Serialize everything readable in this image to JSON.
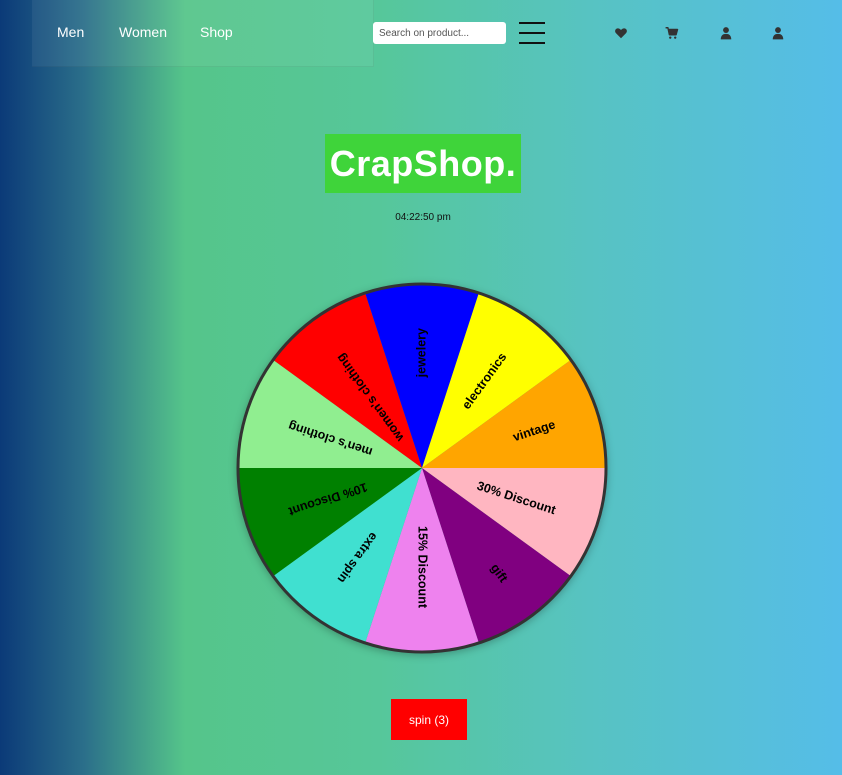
{
  "nav": {
    "links": [
      "Men",
      "Women",
      "Shop"
    ],
    "search_placeholder": "Search on product..."
  },
  "header_icons": [
    "heart-icon",
    "cart-icon",
    "user-icon",
    "account-icon"
  ],
  "logo": {
    "text": "CrapShop.",
    "bg_color": "#3fd43a"
  },
  "clock": {
    "time": "04:22:50 pm"
  },
  "wheel": {
    "segments": [
      {
        "label": "30% Discount",
        "color": "#ffb6c1"
      },
      {
        "label": "gift",
        "color": "#800080"
      },
      {
        "label": "15% Discount",
        "color": "#ee82ee"
      },
      {
        "label": "extra spin",
        "color": "#40e0d0"
      },
      {
        "label": "10% Discount",
        "color": "#008000"
      },
      {
        "label": "men's clothing",
        "color": "#90ee90"
      },
      {
        "label": "women's clothing",
        "color": "#ff0000"
      },
      {
        "label": "jewelery",
        "color": "#0000ff"
      },
      {
        "label": "electronics",
        "color": "#ffff00"
      },
      {
        "label": "vintage",
        "color": "#ffa500"
      }
    ]
  },
  "spin_button": {
    "label": "spin (3)",
    "color": "#ff0000"
  }
}
